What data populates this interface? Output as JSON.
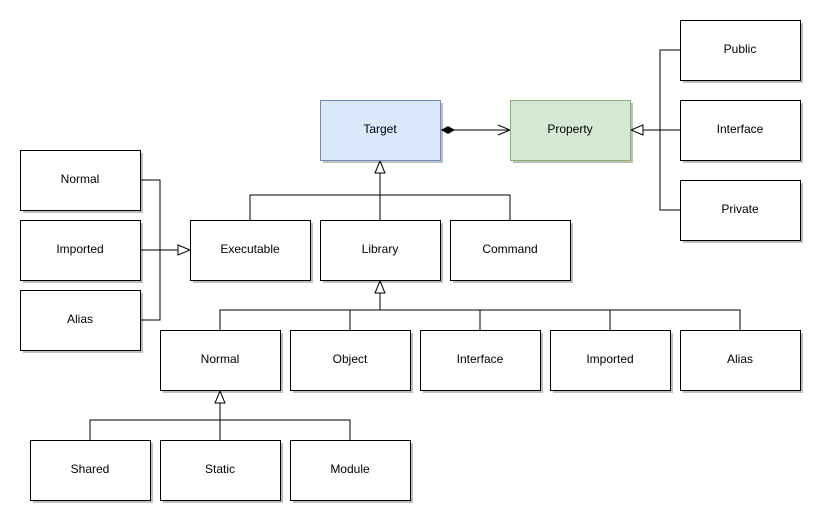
{
  "nodes": {
    "target": {
      "label": "Target",
      "fill": "#dae8fc",
      "stroke": "#6c8ebf"
    },
    "property": {
      "label": "Property",
      "fill": "#d5e8d4",
      "stroke": "#82b366"
    },
    "public": {
      "label": "Public"
    },
    "interface_prop": {
      "label": "Interface"
    },
    "private": {
      "label": "Private"
    },
    "normal_exe": {
      "label": "Normal"
    },
    "imported_exe": {
      "label": "Imported"
    },
    "alias_exe": {
      "label": "Alias"
    },
    "executable": {
      "label": "Executable"
    },
    "library": {
      "label": "Library"
    },
    "command": {
      "label": "Command"
    },
    "normal_lib": {
      "label": "Normal"
    },
    "object_lib": {
      "label": "Object"
    },
    "interface_lib": {
      "label": "Interface"
    },
    "imported_lib": {
      "label": "Imported"
    },
    "alias_lib": {
      "label": "Alias"
    },
    "shared": {
      "label": "Shared"
    },
    "static": {
      "label": "Static"
    },
    "module": {
      "label": "Module"
    }
  }
}
